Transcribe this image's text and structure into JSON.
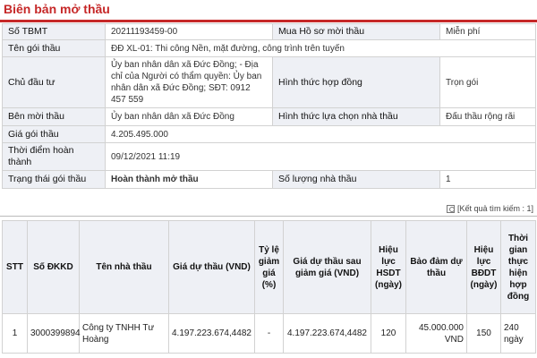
{
  "page": {
    "title": "Biên bản mở thầu"
  },
  "info": {
    "so_tbmt_label": "Số TBMT",
    "so_tbmt_value": "20211193459-00",
    "mua_hs_label": "Mua Hồ sơ mời thầu",
    "mua_hs_value": "Miễn phí",
    "ten_goi_label": "Tên gói thầu",
    "ten_goi_value": "ĐĐ XL-01: Thi công Nền, mặt đường, công trình trên tuyến",
    "chu_dau_tu_label": "Chủ đầu tư",
    "chu_dau_tu_value": "Ủy ban nhân dân xã Đức Đồng; - Địa chỉ của Người có thẩm quyền: Ủy ban nhân dân xã Đức Đồng; SĐT: 0912 457 559",
    "hinh_thuc_hd_label": "Hình thức hợp đồng",
    "hinh_thuc_hd_value": "Trọn gói",
    "ben_moi_thau_label": "Bên mời thầu",
    "ben_moi_thau_value": "Ủy ban nhân dân xã Đức Đồng",
    "hinh_thuc_lc_label": "Hình thức lựa chọn nhà thầu",
    "hinh_thuc_lc_value": "Đấu thầu rộng rãi",
    "gia_goi_label": "Giá gói thầu",
    "gia_goi_value": "4.205.495.000",
    "thoi_diem_label": "Thời điểm hoàn thành",
    "thoi_diem_value": "09/12/2021 11:19",
    "trang_thai_label": "Trạng thái gói thầu",
    "trang_thai_value": "Hoàn thành mở thầu",
    "so_luong_label": "Số lượng nhà thầu",
    "so_luong_value": "1",
    "status_color": "#d32f2f"
  },
  "results": {
    "count_text": "[Kết quả tìm kiếm : 1]",
    "icon": "search-result-icon"
  },
  "bidders": {
    "headers": [
      "STT",
      "Số ĐKKD",
      "Tên nhà thầu",
      "Giá dự thầu (VND)",
      "Tỷ lệ giảm giá (%)",
      "Giá dự thầu sau giảm giá (VND)",
      "Hiệu lực HSDT (ngày)",
      "Bảo đảm dự thầu",
      "Hiệu lực BĐDT (ngày)",
      "Thời gian thực hiện hợp đồng"
    ],
    "rows": [
      {
        "stt": "1",
        "so_dkkd": "3000399894",
        "ten_nha_thau": "Công ty TNHH Tư Hoàng",
        "gia_du_thau": "4.197.223.674,4482",
        "ty_le_giam": "-",
        "gia_sau_giam": "4.197.223.674,4482",
        "hieu_luc_hsdt": "120",
        "bao_dam": "45.000.000 VND",
        "hieu_luc_bddt": "150",
        "thoi_gian": "240 ngày"
      }
    ]
  },
  "colors": {
    "title_red": "#c62828",
    "label_bg": "#eef0f5",
    "border": "#d2d2d2"
  }
}
